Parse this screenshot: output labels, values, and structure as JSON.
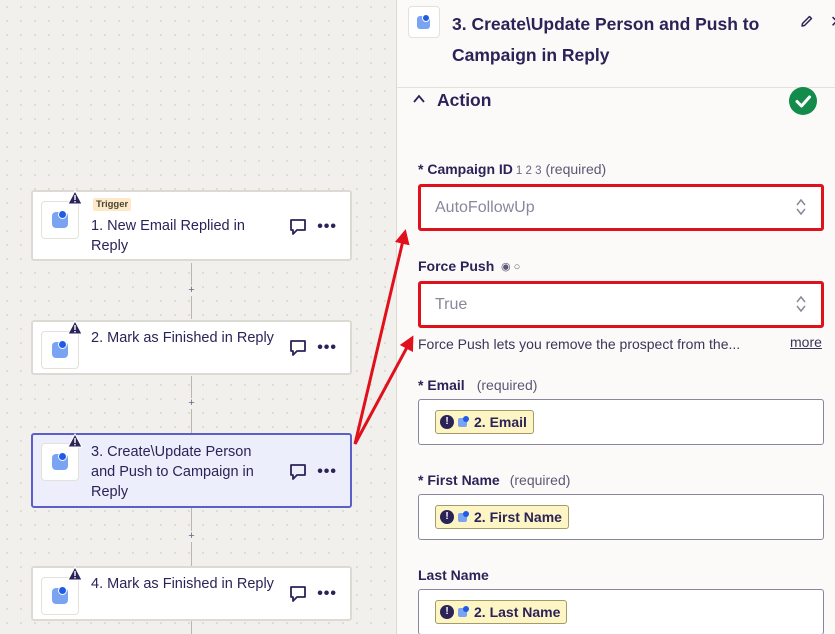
{
  "workflow": {
    "steps": [
      {
        "badge": "Trigger",
        "title": "1. New Email Replied in Reply"
      },
      {
        "badge": "",
        "title": "2. Mark as Finished in Reply"
      },
      {
        "badge": "",
        "title": "3. Create\\Update Person and Push to Campaign in Reply"
      },
      {
        "badge": "",
        "title": "4. Mark as Finished in Reply"
      }
    ],
    "add_step_symbol": "+"
  },
  "panel": {
    "title": "3. Create\\Update Person and Push to Campaign in Reply",
    "section_title": "Action",
    "fields": {
      "campaign": {
        "label": "* Campaign ID",
        "hint": "1 2 3",
        "required": "(required)",
        "value": "AutoFollowUp"
      },
      "force_push": {
        "label": "Force Push",
        "radio": "◉ ○",
        "value": "True",
        "help": "Force Push lets you remove the prospect from the...",
        "more": "more"
      },
      "email": {
        "label": "* Email",
        "required": "(required)",
        "token": "2. Email"
      },
      "first_name": {
        "label": "* First Name",
        "required": "(required)",
        "token": "2. First Name"
      },
      "last_name": {
        "label": "Last Name",
        "token": "2. Last Name"
      }
    }
  },
  "colors": {
    "highlight": "#e0101c",
    "selected_border": "#5b5fc7",
    "success": "#138b4a",
    "token_bg": "#fdf5c4"
  },
  "icons": [
    "warning-icon",
    "comment-icon",
    "more-icon",
    "pencil-icon",
    "close-icon",
    "chevron-up-icon",
    "check-icon",
    "updown-icon",
    "alert-icon",
    "app-icon"
  ]
}
